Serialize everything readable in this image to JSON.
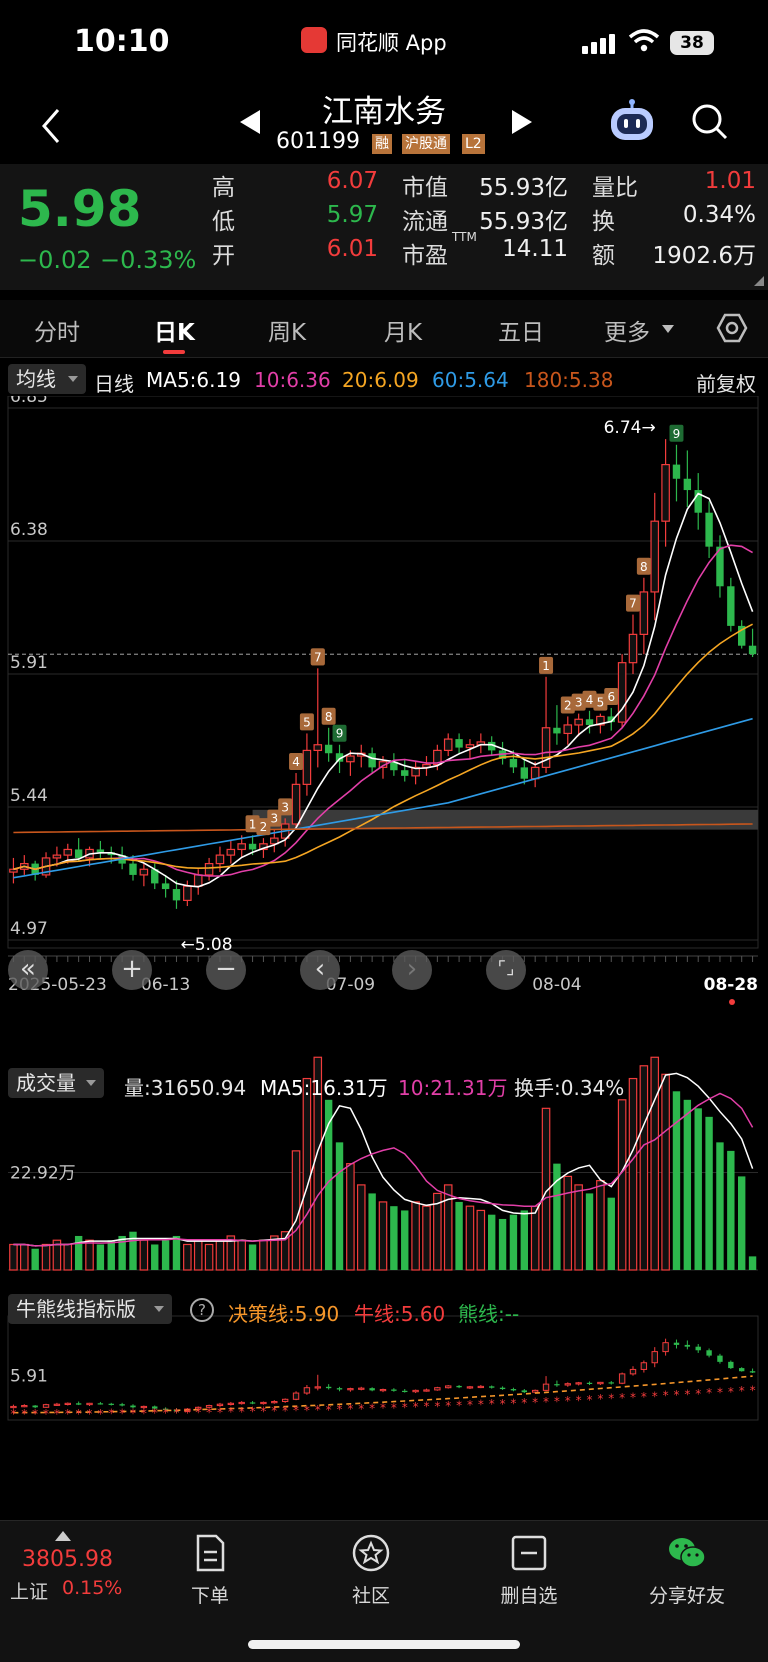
{
  "status": {
    "time": "10:10",
    "app": "同花顺 App",
    "battery": "38"
  },
  "header": {
    "name": "江南水务",
    "code": "601199",
    "tags": [
      "融",
      "沪股通",
      "L2"
    ]
  },
  "quote": {
    "price": "5.98",
    "change": "−0.02",
    "change_pct": "−0.33%",
    "high_label": "高",
    "high": "6.07",
    "low_label": "低",
    "low": "5.97",
    "open_label": "开",
    "open": "6.01",
    "mcap_label": "市值",
    "mcap": "55.93亿",
    "float_label": "流通",
    "float": "55.93亿",
    "pe_label": "市盈",
    "pe_sup": "TTM",
    "pe": "14.11",
    "vr_label": "量比",
    "vr": "1.01",
    "turn_label": "换",
    "turn": "0.34%",
    "amt_label": "额",
    "amt": "1902.6万"
  },
  "tabs": [
    "分时",
    "日K",
    "周K",
    "月K",
    "五日",
    "更多"
  ],
  "ma_legend": {
    "selector": "均线",
    "period": "日线",
    "ma5": "MA5:6.19",
    "ma10": "10:6.36",
    "ma20": "20:6.09",
    "ma60": "60:5.64",
    "ma180": "180:5.38",
    "adjust": "前复权"
  },
  "colors": {
    "up": "#f23c3c",
    "down": "#2db84d",
    "ma5": "#ffffff",
    "ma10": "#e23fa8",
    "ma20": "#f5a623",
    "ma60": "#2f9be6",
    "ma180": "#c8561c"
  },
  "axis": {
    "price_ticks": [
      "6.85",
      "6.38",
      "5.91",
      "5.44",
      "4.97"
    ],
    "dates": [
      "2025-05-23",
      "06-13",
      "07-09",
      "08-04",
      "08-28"
    ],
    "high_mark": "6.74→",
    "low_mark": "←5.08",
    "vol_tick": "22.92万",
    "ind_tick": "5.91"
  },
  "seq_labels": [
    "1",
    "2",
    "3",
    "3",
    "4",
    "5",
    "6",
    "7",
    "8",
    "9",
    "1",
    "2",
    "3",
    "4",
    "5",
    "6",
    "7",
    "8",
    "9"
  ],
  "volume_legend": {
    "selector": "成交量",
    "vol": "量:31650.94",
    "ma5": "MA5:16.31万",
    "ma10": "10:21.31万",
    "turnover": "换手:0.34%"
  },
  "indicator_legend": {
    "selector": "牛熊线指标版",
    "help": "?",
    "decision": "决策线:5.90",
    "bull": "牛线:5.60",
    "bear": "熊线:--"
  },
  "chart_data": {
    "type": "candlestick",
    "title": "",
    "ylim": [
      4.97,
      6.85
    ],
    "x_labels": [
      "2025-05-23",
      "06-13",
      "07-09",
      "08-04",
      "08-28"
    ],
    "ohlc": [
      [
        5.21,
        5.26,
        5.17,
        5.22
      ],
      [
        5.22,
        5.27,
        5.2,
        5.24
      ],
      [
        5.24,
        5.25,
        5.18,
        5.2
      ],
      [
        5.2,
        5.28,
        5.19,
        5.26
      ],
      [
        5.26,
        5.3,
        5.23,
        5.27
      ],
      [
        5.27,
        5.31,
        5.24,
        5.29
      ],
      [
        5.29,
        5.33,
        5.25,
        5.26
      ],
      [
        5.26,
        5.3,
        5.23,
        5.29
      ],
      [
        5.29,
        5.32,
        5.26,
        5.28
      ],
      [
        5.28,
        5.3,
        5.24,
        5.27
      ],
      [
        5.27,
        5.3,
        5.22,
        5.24
      ],
      [
        5.24,
        5.27,
        5.18,
        5.2
      ],
      [
        5.2,
        5.24,
        5.16,
        5.22
      ],
      [
        5.22,
        5.24,
        5.15,
        5.17
      ],
      [
        5.17,
        5.2,
        5.12,
        5.15
      ],
      [
        5.15,
        5.18,
        5.08,
        5.11
      ],
      [
        5.11,
        5.18,
        5.09,
        5.16
      ],
      [
        5.16,
        5.22,
        5.13,
        5.2
      ],
      [
        5.2,
        5.26,
        5.18,
        5.24
      ],
      [
        5.24,
        5.3,
        5.21,
        5.27
      ],
      [
        5.27,
        5.32,
        5.24,
        5.29
      ],
      [
        5.29,
        5.34,
        5.26,
        5.31
      ],
      [
        5.31,
        5.34,
        5.27,
        5.29
      ],
      [
        5.29,
        5.33,
        5.26,
        5.31
      ],
      [
        5.31,
        5.36,
        5.28,
        5.33
      ],
      [
        5.33,
        5.4,
        5.3,
        5.38
      ],
      [
        5.38,
        5.56,
        5.36,
        5.52
      ],
      [
        5.52,
        5.7,
        5.48,
        5.64
      ],
      [
        5.64,
        5.93,
        5.58,
        5.66
      ],
      [
        5.66,
        5.72,
        5.6,
        5.63
      ],
      [
        5.63,
        5.66,
        5.56,
        5.6
      ],
      [
        5.6,
        5.64,
        5.55,
        5.62
      ],
      [
        5.62,
        5.66,
        5.58,
        5.63
      ],
      [
        5.63,
        5.65,
        5.56,
        5.58
      ],
      [
        5.58,
        5.62,
        5.54,
        5.6
      ],
      [
        5.6,
        5.63,
        5.55,
        5.57
      ],
      [
        5.57,
        5.61,
        5.53,
        5.55
      ],
      [
        5.55,
        5.6,
        5.52,
        5.58
      ],
      [
        5.58,
        5.62,
        5.55,
        5.59
      ],
      [
        5.59,
        5.66,
        5.57,
        5.64
      ],
      [
        5.64,
        5.7,
        5.62,
        5.68
      ],
      [
        5.68,
        5.7,
        5.63,
        5.65
      ],
      [
        5.65,
        5.68,
        5.61,
        5.66
      ],
      [
        5.66,
        5.7,
        5.63,
        5.67
      ],
      [
        5.67,
        5.69,
        5.62,
        5.64
      ],
      [
        5.64,
        5.67,
        5.59,
        5.61
      ],
      [
        5.61,
        5.64,
        5.56,
        5.58
      ],
      [
        5.58,
        5.61,
        5.52,
        5.54
      ],
      [
        5.54,
        5.6,
        5.51,
        5.58
      ],
      [
        5.58,
        5.9,
        5.56,
        5.72
      ],
      [
        5.72,
        5.8,
        5.66,
        5.7
      ],
      [
        5.7,
        5.76,
        5.66,
        5.73
      ],
      [
        5.73,
        5.77,
        5.69,
        5.75
      ],
      [
        5.75,
        5.78,
        5.7,
        5.73
      ],
      [
        5.73,
        5.77,
        5.7,
        5.76
      ],
      [
        5.76,
        5.79,
        5.71,
        5.74
      ],
      [
        5.74,
        5.98,
        5.72,
        5.95
      ],
      [
        5.95,
        6.12,
        5.91,
        6.05
      ],
      [
        6.05,
        6.25,
        5.98,
        6.2
      ],
      [
        6.2,
        6.55,
        6.1,
        6.45
      ],
      [
        6.45,
        6.74,
        6.36,
        6.65
      ],
      [
        6.65,
        6.72,
        6.52,
        6.6
      ],
      [
        6.6,
        6.7,
        6.5,
        6.56
      ],
      [
        6.56,
        6.62,
        6.42,
        6.48
      ],
      [
        6.48,
        6.52,
        6.32,
        6.36
      ],
      [
        6.36,
        6.4,
        6.18,
        6.22
      ],
      [
        6.22,
        6.25,
        6.06,
        6.08
      ],
      [
        6.08,
        6.1,
        6.0,
        6.01
      ],
      [
        6.01,
        6.07,
        5.97,
        5.98
      ]
    ],
    "volume_wan": [
      6,
      6,
      5,
      6,
      7,
      6,
      8,
      7,
      6,
      7,
      8,
      9,
      7,
      6,
      7,
      8,
      6,
      7,
      6,
      7,
      8,
      7,
      6,
      7,
      8,
      9,
      28,
      45,
      50,
      40,
      30,
      25,
      20,
      18,
      16,
      15,
      14,
      16,
      15,
      18,
      20,
      16,
      15,
      14,
      13,
      12,
      13,
      14,
      15,
      38,
      25,
      22,
      20,
      18,
      21,
      17,
      40,
      45,
      48,
      50,
      46,
      42,
      40,
      38,
      36,
      30,
      28,
      22,
      3.2
    ],
    "volume_ylim": [
      0,
      55
    ],
    "ma_series": [
      "MA5",
      "MA10",
      "MA20",
      "MA60",
      "MA180"
    ],
    "decision_line": 5.9,
    "bull_line": 5.6
  },
  "bottom": {
    "index_value": "3805.98",
    "index_name": "上证",
    "index_chg": "0.15%",
    "items": [
      "下单",
      "社区",
      "删自选",
      "分享好友"
    ]
  }
}
